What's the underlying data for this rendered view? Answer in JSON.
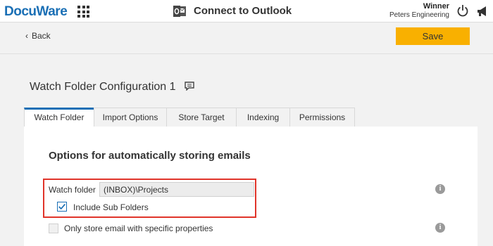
{
  "app": {
    "logo": "DocuWare",
    "title": "Connect to Outlook",
    "user": "Winner",
    "organization": "Peters Engineering"
  },
  "actions": {
    "back_label": "Back",
    "save_label": "Save"
  },
  "config": {
    "title": "Watch Folder Configuration 1"
  },
  "tabs": [
    {
      "label": "Watch Folder",
      "active": true
    },
    {
      "label": "Import Options",
      "active": false
    },
    {
      "label": "Store Target",
      "active": false
    },
    {
      "label": "Indexing",
      "active": false
    },
    {
      "label": "Permissions",
      "active": false
    }
  ],
  "section": {
    "title": "Options for automatically storing emails",
    "watch_folder_label": "Watch folder",
    "watch_folder_value": "(INBOX)\\Projects",
    "include_sub_folders_label": "Include Sub Folders",
    "include_sub_folders_checked": true,
    "specific_properties_label": "Only store email with specific properties",
    "specific_properties_checked": false
  },
  "icons": {
    "apps": "apps-grid-icon",
    "outlook": "outlook-icon",
    "power": "power-icon",
    "announcements": "megaphone-icon",
    "comment": "comment-icon",
    "info": "info-icon"
  },
  "colors": {
    "brand": "#1a6fb5",
    "save": "#f9b000",
    "highlight": "#e0342a"
  }
}
